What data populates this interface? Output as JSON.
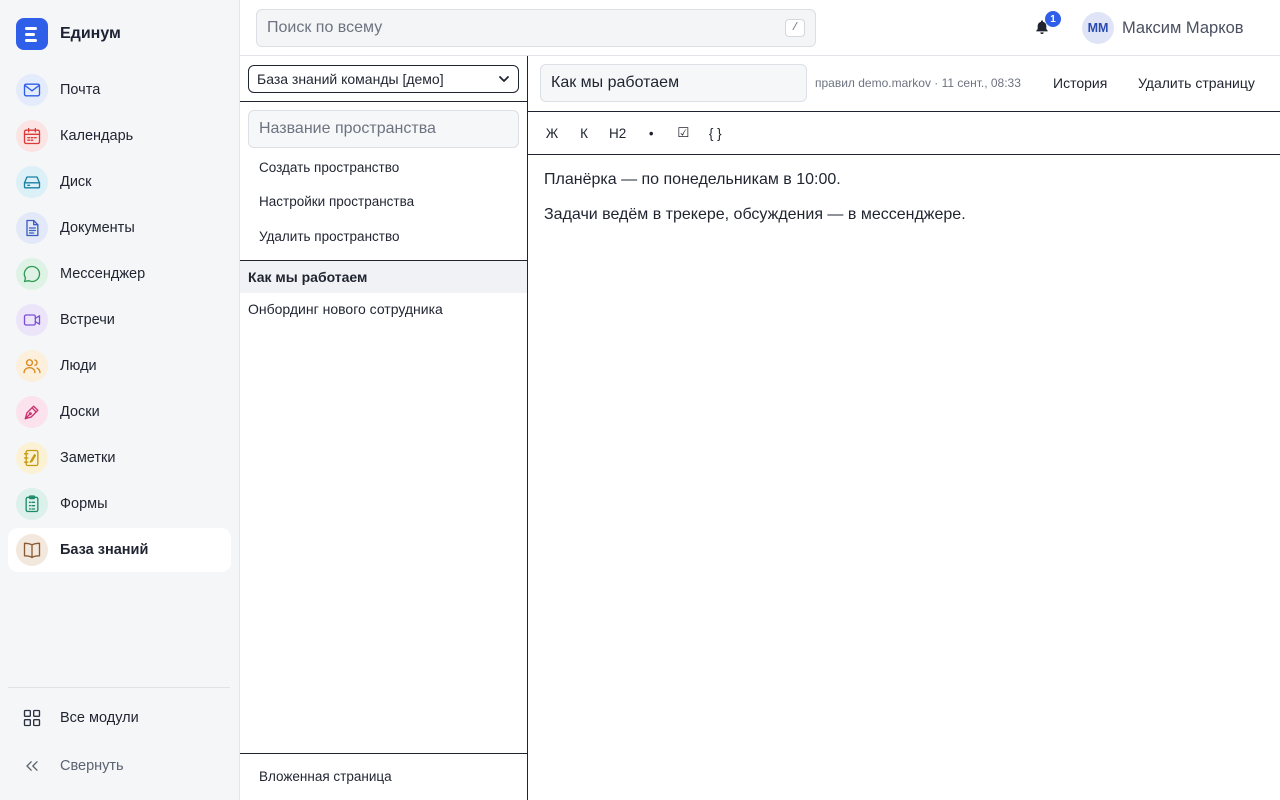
{
  "app": {
    "name": "Единум"
  },
  "sidebar": {
    "items": [
      {
        "label": "Почта",
        "icon": "mail-icon",
        "color": "#2f5fe8",
        "bg": "#e3ebfc"
      },
      {
        "label": "Календарь",
        "icon": "calendar-icon",
        "color": "#d93a3a",
        "bg": "#fce4e4"
      },
      {
        "label": "Диск",
        "icon": "drive-icon",
        "color": "#1b7fa6",
        "bg": "#dcf0f7"
      },
      {
        "label": "Документы",
        "icon": "document-icon",
        "color": "#3b5fc0",
        "bg": "#e3e9f8"
      },
      {
        "label": "Мессенджер",
        "icon": "chat-icon",
        "color": "#2e9a52",
        "bg": "#def3e5"
      },
      {
        "label": "Встречи",
        "icon": "video-icon",
        "color": "#7b4fd6",
        "bg": "#ece5fa"
      },
      {
        "label": "Люди",
        "icon": "people-icon",
        "color": "#d98a1e",
        "bg": "#fcefdc"
      },
      {
        "label": "Доски",
        "icon": "pen-icon",
        "color": "#c92f6e",
        "bg": "#fbe2ec"
      },
      {
        "label": "Заметки",
        "icon": "notes-icon",
        "color": "#c69a12",
        "bg": "#fbf2d6"
      },
      {
        "label": "Формы",
        "icon": "clipboard-icon",
        "color": "#1f8a6a",
        "bg": "#dcf1ea"
      },
      {
        "label": "База знаний",
        "icon": "book-icon",
        "color": "#8a5a33",
        "bg": "#f3e8dd",
        "active": true
      }
    ],
    "all_modules_label": "Все модули",
    "collapse_label": "Свернуть"
  },
  "topbar": {
    "search_placeholder": "Поиск по всему",
    "search_shortcut": "/",
    "notifications_count": "1",
    "user_initials": "ММ",
    "user_name": "Максим Марков"
  },
  "kb": {
    "selected_base": "База знаний команды [демо]",
    "space_name_placeholder": "Название пространства",
    "actions": {
      "create": "Создать пространство",
      "settings": "Настройки пространства",
      "delete": "Удалить пространство"
    },
    "pages": [
      {
        "title": "Как мы работаем",
        "active": true
      },
      {
        "title": "Онбординг нового сотрудника",
        "active": false
      }
    ],
    "subpage_label": "Вложенная страница"
  },
  "editor": {
    "title": "Как мы работаем",
    "meta": "правил demo.markov · 11 сент., 08:33",
    "history_label": "История",
    "delete_page_label": "Удалить страницу",
    "toolbar": [
      "Ж",
      "К",
      "H2",
      "•",
      "☑",
      "{ }"
    ],
    "paragraphs": [
      "Планёрка — по понедельникам в 10:00.",
      "Задачи ведём в трекере, обсуждения — в мессенджере."
    ]
  }
}
